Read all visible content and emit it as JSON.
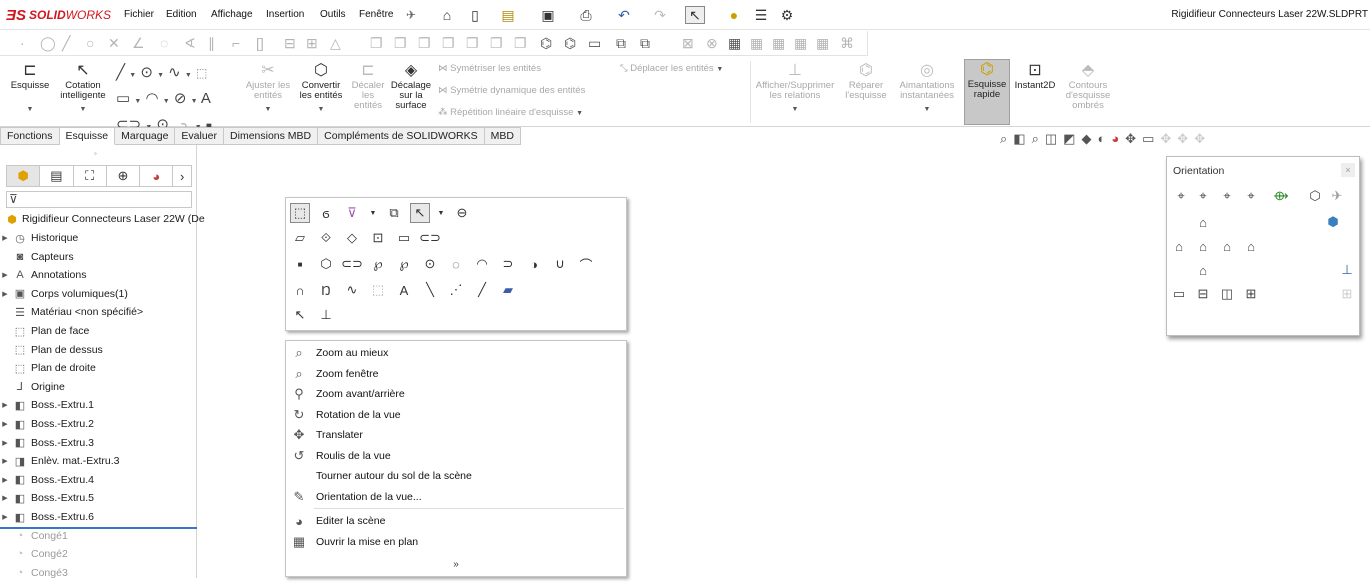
{
  "app": {
    "brand_prefix": "SOLID",
    "brand_suffix": "WORKS",
    "document_title": "Rigidifieur Connecteurs Laser 22W.SLDPRT"
  },
  "menu": [
    "Fichier",
    "Edition",
    "Affichage",
    "Insertion",
    "Outils",
    "Fenêtre"
  ],
  "command_manager": {
    "sketch": "Esquisse",
    "smart_dim_1": "Cotation",
    "smart_dim_2": "intelligente",
    "trim_1": "Ajuster les",
    "trim_2": "entités",
    "convert_1": "Convertir",
    "convert_2": "les entités",
    "offset_1": "Décaler",
    "offset_2": "les",
    "offset_3": "entités",
    "offset_surf_1": "Décalage",
    "offset_surf_2": "sur la",
    "offset_surf_3": "surface",
    "mirror": "Symétriser les entités",
    "dyn_mirror": "Symétrie dynamique des entités",
    "linear_pattern": "Répétition linéaire d'esquisse",
    "move": "Déplacer les entités",
    "relations_1": "Afficher/Supprimer",
    "relations_2": "les relations",
    "repair_1": "Réparer",
    "repair_2": "l'esquisse",
    "snaps_1": "Aimantations",
    "snaps_2": "instantanées",
    "rapid_1": "Esquisse",
    "rapid_2": "rapide",
    "instant2d": "Instant2D",
    "shaded_1": "Contours",
    "shaded_2": "d'esquisse",
    "shaded_3": "ombrés"
  },
  "tabs": [
    "Fonctions",
    "Esquisse",
    "Marquage",
    "Evaluer",
    "Dimensions MBD",
    "Compléments de SOLIDWORKS",
    "MBD"
  ],
  "active_tab": "Esquisse",
  "feature_tree": {
    "root": "Rigidifieur Connecteurs Laser 22W  (De",
    "items": [
      {
        "label": "Historique",
        "icon": "history-icon",
        "expandable": true,
        "suppressed": false
      },
      {
        "label": "Capteurs",
        "icon": "sensor-icon",
        "expandable": false,
        "suppressed": false
      },
      {
        "label": "Annotations",
        "icon": "annotation-icon",
        "expandable": true,
        "suppressed": false
      },
      {
        "label": "Corps volumiques(1)",
        "icon": "solid-bodies-icon",
        "expandable": true,
        "suppressed": false
      },
      {
        "label": "Matériau <non spécifié>",
        "icon": "material-icon",
        "expandable": false,
        "suppressed": false
      },
      {
        "label": "Plan de face",
        "icon": "plane-icon",
        "expandable": false,
        "suppressed": false
      },
      {
        "label": "Plan de dessus",
        "icon": "plane-icon",
        "expandable": false,
        "suppressed": false
      },
      {
        "label": "Plan de droite",
        "icon": "plane-icon",
        "expandable": false,
        "suppressed": false
      },
      {
        "label": "Origine",
        "icon": "origin-icon",
        "expandable": false,
        "suppressed": false
      },
      {
        "label": "Boss.-Extru.1",
        "icon": "extrude-icon",
        "expandable": true,
        "suppressed": false
      },
      {
        "label": "Boss.-Extru.2",
        "icon": "extrude-icon",
        "expandable": true,
        "suppressed": false
      },
      {
        "label": "Boss.-Extru.3",
        "icon": "extrude-icon",
        "expandable": true,
        "suppressed": false
      },
      {
        "label": "Enlèv. mat.-Extru.3",
        "icon": "cut-extrude-icon",
        "expandable": true,
        "suppressed": false
      },
      {
        "label": "Boss.-Extru.4",
        "icon": "extrude-icon",
        "expandable": true,
        "suppressed": false
      },
      {
        "label": "Boss.-Extru.5",
        "icon": "extrude-icon",
        "expandable": true,
        "suppressed": false
      },
      {
        "label": "Boss.-Extru.6",
        "icon": "extrude-icon",
        "expandable": true,
        "suppressed": false
      },
      {
        "label": "Congé1",
        "icon": "fillet-icon",
        "expandable": false,
        "suppressed": true
      },
      {
        "label": "Congé2",
        "icon": "fillet-icon",
        "expandable": false,
        "suppressed": true
      },
      {
        "label": "Congé3",
        "icon": "fillet-icon",
        "expandable": false,
        "suppressed": true
      }
    ]
  },
  "context_menu": [
    {
      "label": "Zoom au mieux",
      "icon": "zoom-fit-icon"
    },
    {
      "label": "Zoom fenêtre",
      "icon": "zoom-window-icon"
    },
    {
      "label": "Zoom avant/arrière",
      "icon": "zoom-in-out-icon"
    },
    {
      "label": "Rotation de la vue",
      "icon": "rotate-view-icon"
    },
    {
      "label": "Translater",
      "icon": "pan-icon"
    },
    {
      "label": "Roulis de la vue",
      "icon": "roll-view-icon"
    },
    {
      "label": "Tourner autour du sol de la scène",
      "icon": ""
    },
    {
      "label": "Orientation de la vue...",
      "icon": "view-orientation-icon"
    },
    {
      "label": "Editer la scène",
      "icon": "edit-scene-icon"
    },
    {
      "label": "Ouvrir la mise en plan",
      "icon": "open-drawing-icon"
    }
  ],
  "context_more": "»",
  "orientation": {
    "title": "Orientation",
    "close": "×"
  }
}
